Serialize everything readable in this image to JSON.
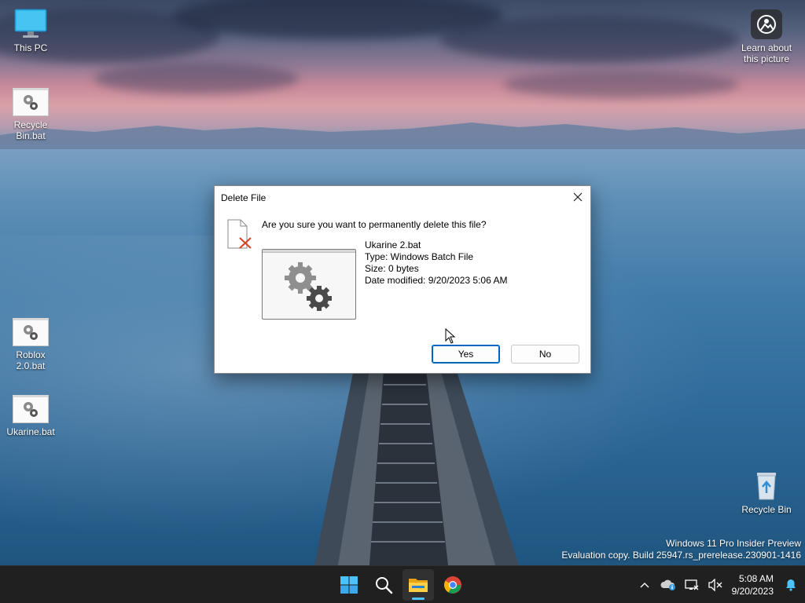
{
  "desktop": {
    "icons": [
      {
        "label": "This PC",
        "icon": "monitor-icon"
      },
      {
        "label": "Recycle Bin.bat",
        "icon": "batch-file-icon"
      },
      {
        "label": "Roblox 2.0.bat",
        "icon": "batch-file-icon"
      },
      {
        "label": "Ukarine.bat",
        "icon": "batch-file-icon"
      },
      {
        "label": "Recycle Bin",
        "icon": "recycle-bin-icon"
      }
    ],
    "learn_about": "Learn about this picture"
  },
  "dialog": {
    "title": "Delete File",
    "question": "Are you sure you want to permanently delete this file?",
    "file_name": "Ukarine 2.bat",
    "file_type": "Type: Windows Batch File",
    "file_size": "Size: 0 bytes",
    "date_modified": "Date modified: 9/20/2023 5:06 AM",
    "yes_label": "Yes",
    "no_label": "No"
  },
  "watermark": {
    "line1": "Windows 11 Pro Insider Preview",
    "line2": "Evaluation copy. Build 25947.rs_prerelease.230901-1416"
  },
  "taskbar": {
    "time": "5:08 AM",
    "date": "9/20/2023",
    "apps": [
      "start",
      "search",
      "file-explorer",
      "chrome"
    ],
    "accent": "#4cc2ff"
  }
}
